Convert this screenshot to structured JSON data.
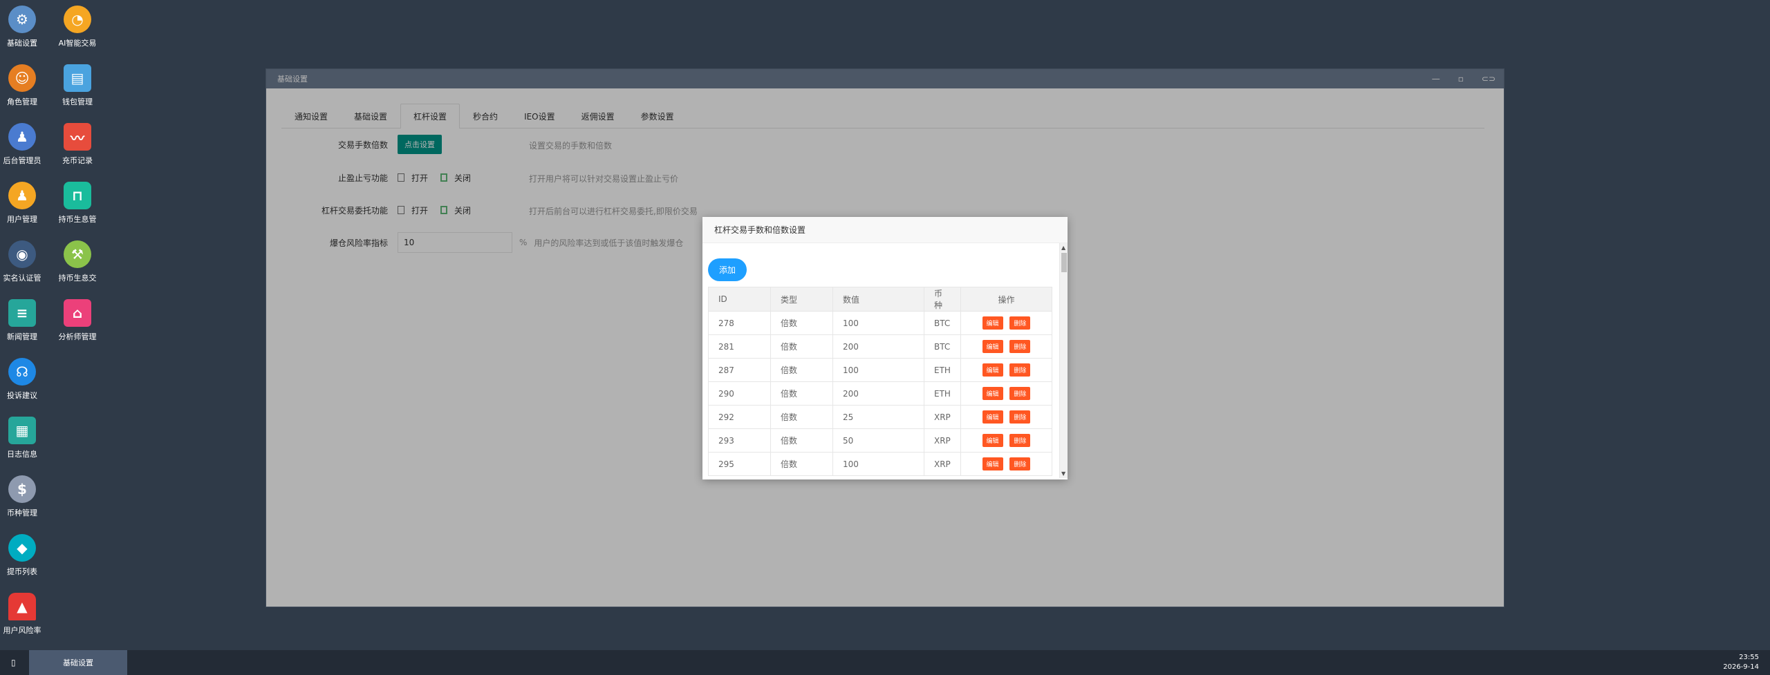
{
  "desktop": {
    "icons": [
      {
        "label": "基础设置",
        "icon": "gear-icon",
        "color": "#5b8ec7"
      },
      {
        "label": "AI智能交易",
        "icon": "stopwatch-icon",
        "color": "#f5a623"
      },
      {
        "label": "角色管理",
        "icon": "role-icon",
        "color": "#e67e22"
      },
      {
        "label": "钱包管理",
        "icon": "wallet-icon",
        "color": "#4aa3df"
      },
      {
        "label": "后台管理员",
        "icon": "admin-icon",
        "color": "#4a7bd0"
      },
      {
        "label": "充币记录",
        "icon": "chart-icon",
        "color": "#e74c3c"
      },
      {
        "label": "用户管理",
        "icon": "user-search-icon",
        "color": "#f5a623"
      },
      {
        "label": "持币生息管",
        "icon": "unlock-icon",
        "color": "#1abc9c"
      },
      {
        "label": "实名认证管",
        "icon": "id-icon",
        "color": "#3d5a80"
      },
      {
        "label": "持币生息交",
        "icon": "hammer-icon",
        "color": "#8bc34a"
      },
      {
        "label": "新闻管理",
        "icon": "news-icon",
        "color": "#26a69a"
      },
      {
        "label": "分析师管理",
        "icon": "shop-icon",
        "color": "#ec407a"
      },
      {
        "label": "投诉建议",
        "icon": "headset-icon",
        "color": "#1e88e5"
      },
      {
        "label": "日志信息",
        "icon": "log-icon",
        "color": "#26a69a"
      },
      {
        "label": "币种管理",
        "icon": "dollar-icon",
        "color": "#8e9aaf"
      },
      {
        "label": "提币列表",
        "icon": "withdraw-icon",
        "color": "#00acc1"
      },
      {
        "label": "用户风险率",
        "icon": "alarm-icon",
        "color": "#e53935"
      }
    ]
  },
  "window": {
    "title": "基础设置",
    "controls": {
      "minimize": "—",
      "maximize": "▫",
      "fullscreen": "⊂⊃"
    },
    "tabs": [
      "通知设置",
      "基础设置",
      "杠杆设置",
      "秒合约",
      "IEO设置",
      "返佣设置",
      "参数设置"
    ],
    "active_tab": 2,
    "form": {
      "row1": {
        "label": "交易手数倍数",
        "button": "点击设置",
        "tip": "设置交易的手数和倍数"
      },
      "row2": {
        "label": "止盈止亏功能",
        "opt_on": "打开",
        "opt_off": "关闭",
        "tip": "打开用户将可以针对交易设置止盈止亏价"
      },
      "row3": {
        "label": "杠杆交易委托功能",
        "opt_on": "打开",
        "opt_off": "关闭",
        "tip": "打开后前台可以进行杠杆交易委托,即限价交易"
      },
      "row4": {
        "label": "爆仓风险率指标",
        "value": "10",
        "unit": "%",
        "tip": "用户的风险率达到或低于该值时触发爆仓"
      }
    }
  },
  "modal": {
    "title": "杠杆交易手数和倍数设置",
    "add_button": "添加",
    "columns": [
      "ID",
      "类型",
      "数值",
      "币种",
      "操作"
    ],
    "edit_label": "编辑",
    "delete_label": "删除",
    "edit_color": "#ff5722",
    "delete_color": "#ff5722",
    "rows": [
      [
        "278",
        "倍数",
        "100",
        "BTC"
      ],
      [
        "281",
        "倍数",
        "200",
        "BTC"
      ],
      [
        "287",
        "倍数",
        "100",
        "ETH"
      ],
      [
        "290",
        "倍数",
        "200",
        "ETH"
      ],
      [
        "292",
        "倍数",
        "25",
        "XRP"
      ],
      [
        "293",
        "倍数",
        "50",
        "XRP"
      ],
      [
        "295",
        "倍数",
        "100",
        "XRP"
      ]
    ]
  },
  "taskbar": {
    "start_icon": "▯",
    "active_task": "基础设置",
    "time": "23:55",
    "date": "2026-9-14"
  }
}
